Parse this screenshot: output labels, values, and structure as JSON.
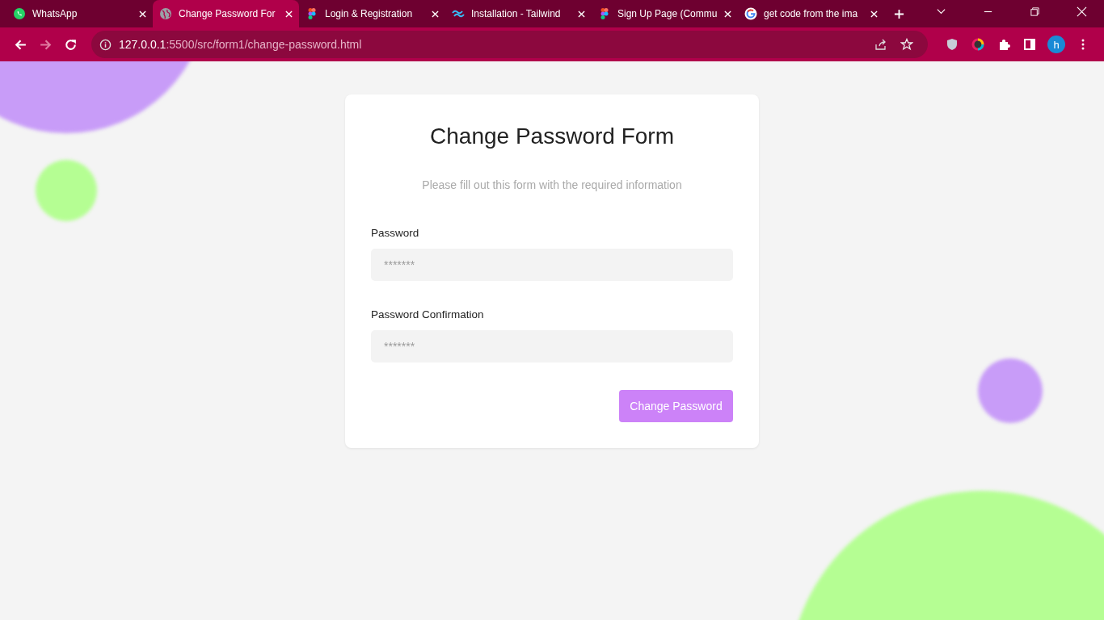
{
  "browser": {
    "tabs": [
      {
        "title": "WhatsApp",
        "kind": "whatsapp",
        "selected": false
      },
      {
        "title": "Change Password For",
        "kind": "globe",
        "selected": true
      },
      {
        "title": "Login & Registration",
        "kind": "figma",
        "selected": false
      },
      {
        "title": "Installation - Tailwind",
        "kind": "tailwind",
        "selected": false
      },
      {
        "title": "Sign Up Page (Commu",
        "kind": "figma",
        "selected": false
      },
      {
        "title": "get code from the ima",
        "kind": "google",
        "selected": false
      }
    ],
    "url": {
      "host": "127.0.0.1",
      "path": ":5500/src/form1/change-password.html"
    },
    "profile": "h"
  },
  "form": {
    "title": "Change Password Form",
    "subtitle": "Please fill out this form with the required information",
    "fields": [
      {
        "label": "Password",
        "placeholder": "*******"
      },
      {
        "label": "Password Confirmation",
        "placeholder": "*******"
      }
    ],
    "submit": "Change Password"
  }
}
